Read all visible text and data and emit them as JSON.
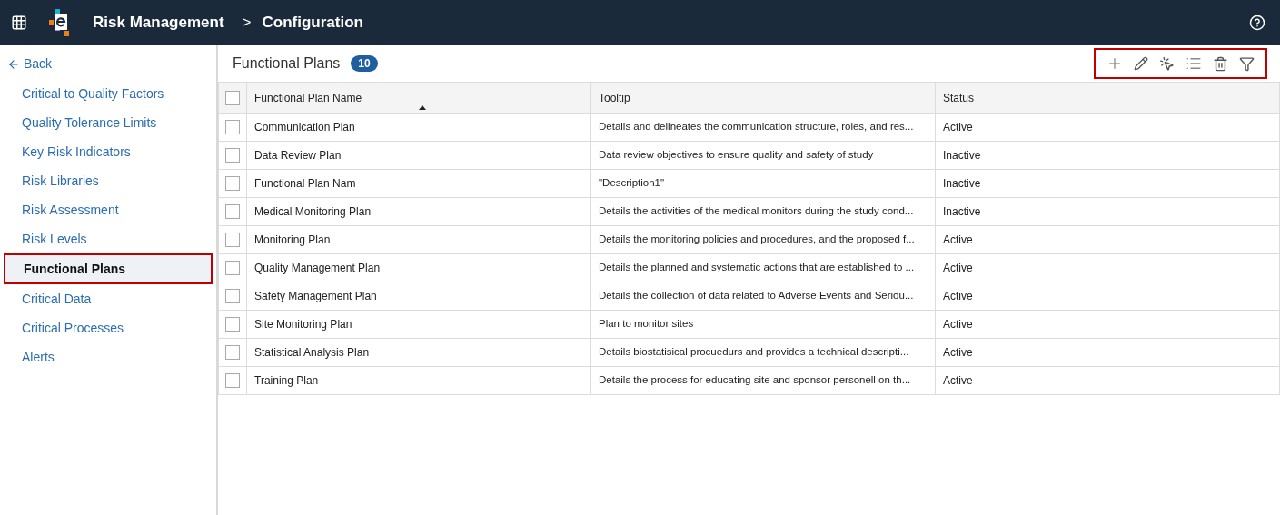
{
  "header": {
    "app_title": "Risk Management",
    "breadcrumb_separator": ">",
    "page_title": "Configuration"
  },
  "sidebar": {
    "back": "Back",
    "items": [
      {
        "label": "Critical to Quality Factors",
        "selected": false
      },
      {
        "label": "Quality Tolerance Limits",
        "selected": false
      },
      {
        "label": "Key Risk Indicators",
        "selected": false
      },
      {
        "label": "Risk Libraries",
        "selected": false
      },
      {
        "label": "Risk Assessment",
        "selected": false
      },
      {
        "label": "Risk Levels",
        "selected": false
      },
      {
        "label": "Functional Plans",
        "selected": true
      },
      {
        "label": "Critical Data",
        "selected": false
      },
      {
        "label": "Critical Processes",
        "selected": false
      },
      {
        "label": "Alerts",
        "selected": false
      }
    ]
  },
  "panel": {
    "title": "Functional Plans",
    "count": "10",
    "toolbar_highlighted": true
  },
  "table": {
    "select_all_checked": false,
    "columns": [
      {
        "label": "Functional Plan Name",
        "sorted": true
      },
      {
        "label": "Tooltip"
      },
      {
        "label": "Status"
      }
    ],
    "rows": [
      {
        "checked": false,
        "name": "Communication Plan",
        "tooltip": "Details and delineates the communication structure, roles, and res...",
        "status": "Active"
      },
      {
        "checked": false,
        "name": "Data Review Plan",
        "tooltip": "Data review objectives to ensure quality and safety of study",
        "status": "Inactive"
      },
      {
        "checked": false,
        "name": "Functional Plan Nam",
        "tooltip": "\"Description1\"",
        "status": "Inactive"
      },
      {
        "checked": false,
        "name": "Medical Monitoring Plan",
        "tooltip": "Details the activities of the medical monitors during the study cond...",
        "status": "Inactive"
      },
      {
        "checked": false,
        "name": "Monitoring Plan",
        "tooltip": "Details the monitoring policies and procedures, and the proposed f...",
        "status": "Active"
      },
      {
        "checked": false,
        "name": "Quality Management Plan",
        "tooltip": "Details the planned and systematic actions that are established to ...",
        "status": "Active"
      },
      {
        "checked": false,
        "name": "Safety Management Plan",
        "tooltip": "Details the collection of data related to Adverse Events and Seriou...",
        "status": "Active"
      },
      {
        "checked": false,
        "name": "Site Monitoring Plan",
        "tooltip": "Plan to monitor sites",
        "status": "Active"
      },
      {
        "checked": false,
        "name": "Statistical Analysis Plan",
        "tooltip": "Details biostatisical procuedurs and provides a technical descripti...",
        "status": "Active"
      },
      {
        "checked": false,
        "name": "Training Plan",
        "tooltip": "Details the process for educating site and sponsor personell on th...",
        "status": "Active"
      }
    ]
  }
}
